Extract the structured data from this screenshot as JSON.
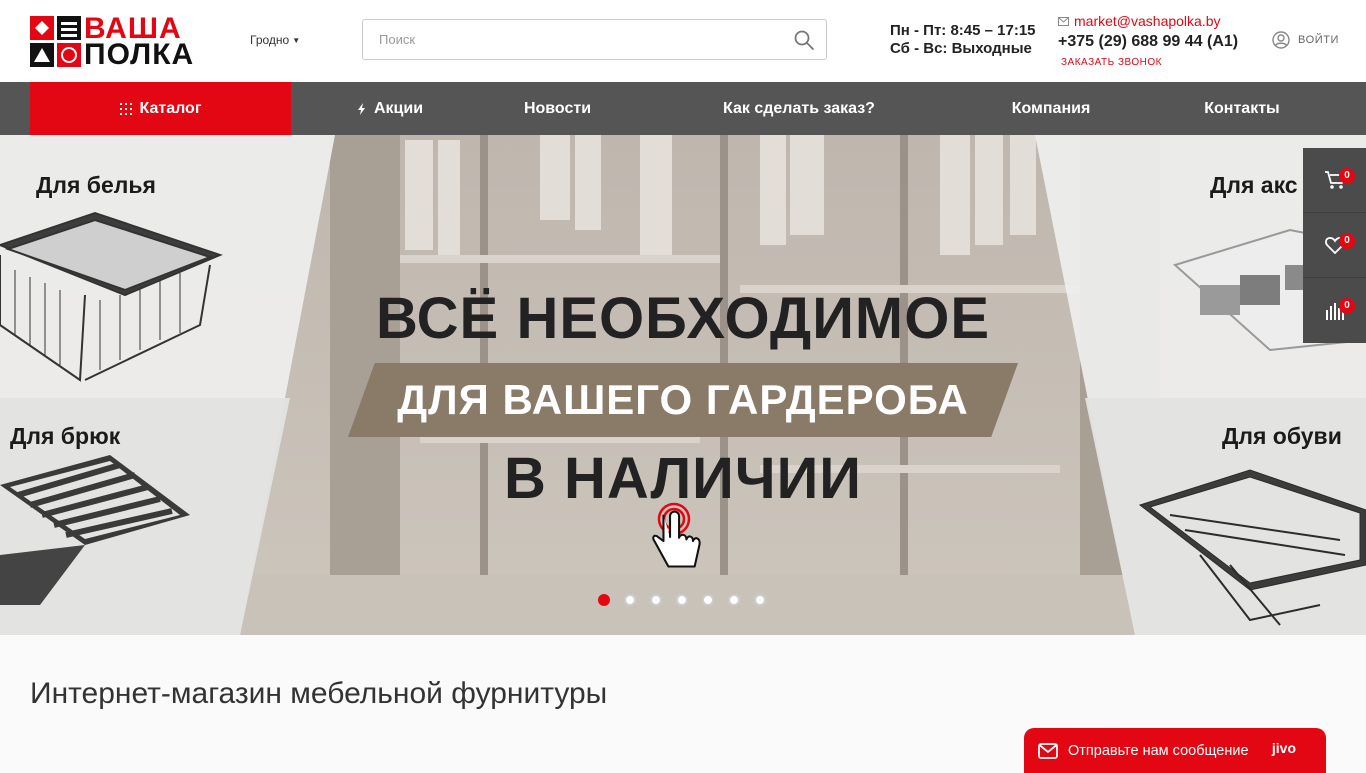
{
  "header": {
    "logo_line1": "ВАША",
    "logo_line2": "ПОЛКА",
    "city": "Гродно",
    "search_placeholder": "Поиск",
    "hours_weekday": "Пн - Пт: 8:45 – 17:15",
    "hours_weekend": "Сб - Вс: Выходные",
    "email": "market@vashapolka.by",
    "phone": "+375 (29) 688 99 44 (A1)",
    "callback": "ЗАКАЗАТЬ ЗВОНОК",
    "login": "ВОЙТИ"
  },
  "nav": {
    "catalog": "Каталог",
    "promotions": "Акции",
    "news": "Новости",
    "how_to_order": "Как сделать заказ?",
    "company": "Компания",
    "contacts": "Контакты"
  },
  "hero": {
    "label_top_left": "Для белья",
    "label_top_right": "Для акс",
    "label_bottom_left": "Для брюк",
    "label_bottom_right": "Для обуви",
    "headline1": "ВСЁ НЕОБХОДИМОЕ",
    "headline2": "ДЛЯ ВАШЕГО ГАРДЕРОБА",
    "headline3": "В НАЛИЧИИ",
    "slides_count": 7,
    "active_slide": 1
  },
  "side_toolbar": {
    "cart_count": "0",
    "wishlist_count": "0",
    "compare_count": "0"
  },
  "main": {
    "title": "Интернет-магазин мебельной фурнитуры"
  },
  "chat": {
    "label": "Отправьте нам сообщение",
    "brand": "jivo"
  },
  "colors": {
    "accent": "#e30613",
    "nav_bg": "#555555",
    "side_bg": "#4b4b4b"
  }
}
